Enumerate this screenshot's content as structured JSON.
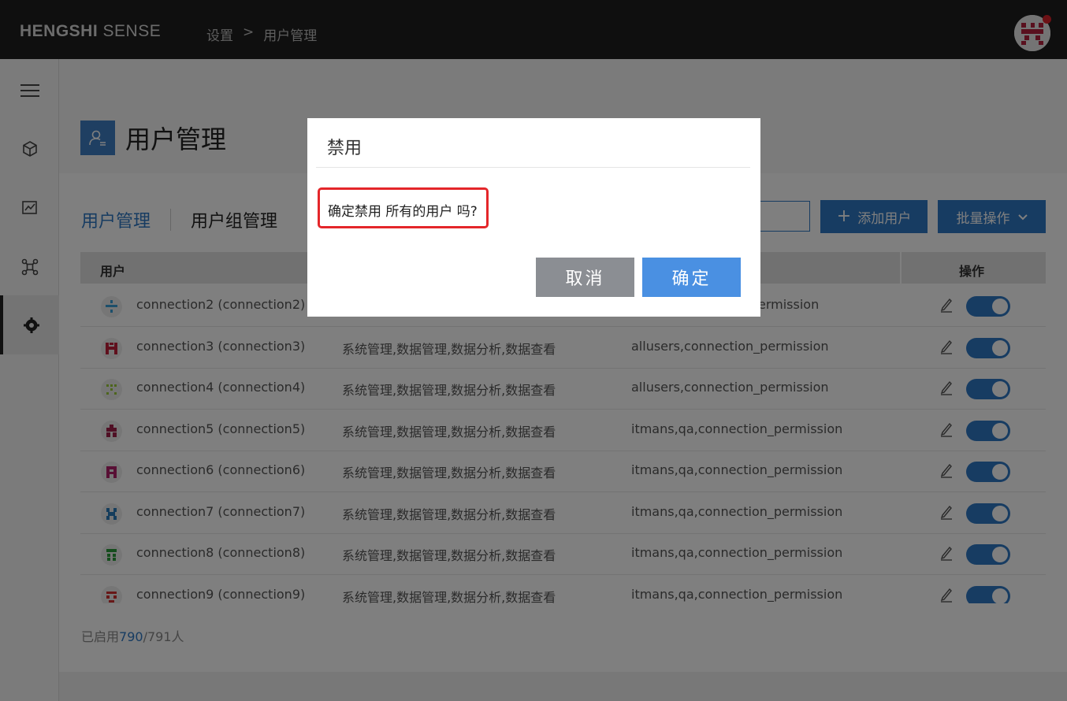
{
  "app": {
    "brand_bold": "HENGSHI",
    "brand_light": "SENSE",
    "breadcrumb": [
      "设置",
      ">",
      "用户管理"
    ]
  },
  "page": {
    "title": "用户管理",
    "tabs": [
      {
        "label": "用户管理",
        "active": true
      },
      {
        "label": "用户组管理",
        "active": false
      }
    ],
    "add_button": "添加用户",
    "batch_button": "批量操作"
  },
  "table": {
    "headers": {
      "user": "用户",
      "actions": "操作"
    },
    "rows": [
      {
        "name": "connection2 (connection2)",
        "roles": "",
        "groups": "ermission",
        "enabled": true
      },
      {
        "name": "connection3 (connection3)",
        "roles": "系统管理,数据管理,数据分析,数据查看",
        "groups": "allusers,connection_permission",
        "enabled": true
      },
      {
        "name": "connection4 (connection4)",
        "roles": "系统管理,数据管理,数据分析,数据查看",
        "groups": "allusers,connection_permission",
        "enabled": true
      },
      {
        "name": "connection5 (connection5)",
        "roles": "系统管理,数据管理,数据分析,数据查看",
        "groups": "itmans,qa,connection_permission",
        "enabled": true
      },
      {
        "name": "connection6 (connection6)",
        "roles": "系统管理,数据管理,数据分析,数据查看",
        "groups": "itmans,qa,connection_permission",
        "enabled": true
      },
      {
        "name": "connection7 (connection7)",
        "roles": "系统管理,数据管理,数据分析,数据查看",
        "groups": "itmans,qa,connection_permission",
        "enabled": true
      },
      {
        "name": "connection8 (connection8)",
        "roles": "系统管理,数据管理,数据分析,数据查看",
        "groups": "itmans,qa,connection_permission",
        "enabled": true
      },
      {
        "name": "connection9 (connection9)",
        "roles": "系统管理,数据管理,数据分析,数据查看",
        "groups": "itmans,qa,connection_permission",
        "enabled": true
      }
    ]
  },
  "footer": {
    "prefix": "已启用",
    "enabled_count": "790",
    "suffix": "/791人"
  },
  "modal": {
    "title": "禁用",
    "message": "确定禁用 所有的用户 吗?",
    "cancel_label": "取消",
    "ok_label": "确定"
  },
  "colors": {
    "accent": "#2f78c4",
    "topbar": "#1f1f1f",
    "highlight_border": "#e4262a",
    "ok_button": "#4a90e2",
    "cancel_button": "#8b8e93"
  }
}
